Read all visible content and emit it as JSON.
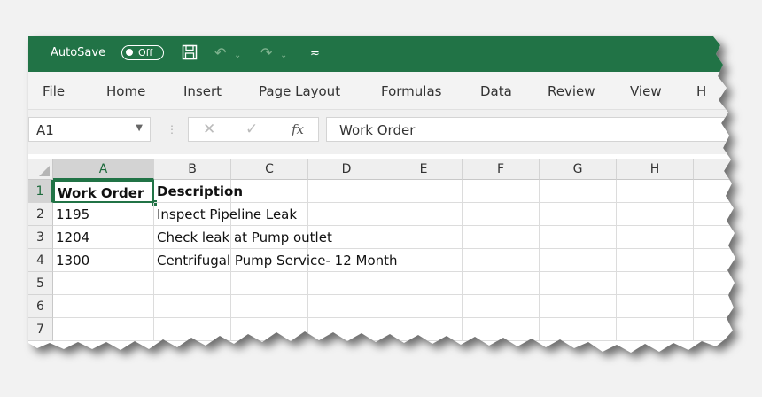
{
  "titlebar": {
    "autosave_label": "AutoSave",
    "autosave_state": "Off",
    "icons": [
      "save-icon",
      "undo-icon",
      "redo-icon",
      "customize-quick-access-icon"
    ]
  },
  "menu": [
    "File",
    "Home",
    "Insert",
    "Page Layout",
    "Formulas",
    "Data",
    "Review",
    "View",
    "H"
  ],
  "formula_bar": {
    "name_box": "A1",
    "fx_label": "fx",
    "content": "Work Order"
  },
  "sheet": {
    "columns": [
      "A",
      "B",
      "C",
      "D",
      "E",
      "F",
      "G",
      "H"
    ],
    "row_numbers": [
      "1",
      "2",
      "3",
      "4",
      "5",
      "6",
      "7"
    ],
    "rows": [
      {
        "a": "Work Order",
        "b": "Description"
      },
      {
        "a": "1195",
        "b": "Inspect Pipeline Leak"
      },
      {
        "a": "1204",
        "b": "Check leak at Pump outlet"
      },
      {
        "a": "1300",
        "b": "Centrifugal Pump Service- 12 Month"
      }
    ],
    "selected_cell": "A1"
  },
  "colors": {
    "accent": "#217346",
    "ribbon_bg": "#f3f3f3",
    "header_bg": "#efefef"
  }
}
